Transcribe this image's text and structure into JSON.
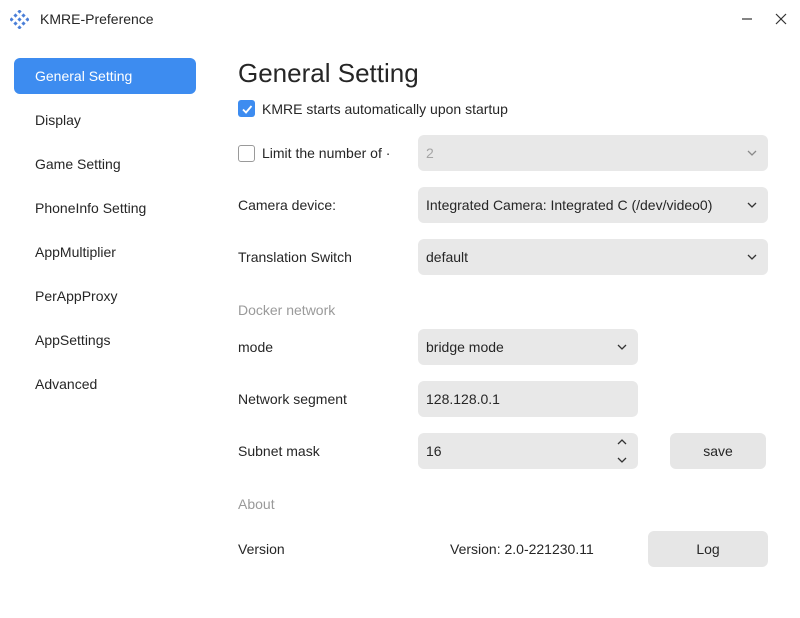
{
  "window": {
    "title": "KMRE-Preference",
    "logo_icon": "app-logo-icon",
    "minimize_icon": "minimize-icon",
    "close_icon": "close-icon"
  },
  "sidebar": {
    "items": [
      {
        "label": "General Setting",
        "active": true
      },
      {
        "label": "Display"
      },
      {
        "label": "Game Setting"
      },
      {
        "label": "PhoneInfo Setting"
      },
      {
        "label": "AppMultiplier"
      },
      {
        "label": "PerAppProxy"
      },
      {
        "label": "AppSettings"
      },
      {
        "label": "Advanced"
      }
    ]
  },
  "main": {
    "title": "General Setting",
    "autostart": {
      "label": "KMRE starts automatically upon startup",
      "checked": true
    },
    "limit": {
      "label": "Limit the number of ·",
      "checked": false,
      "value": "2"
    },
    "camera": {
      "label": "Camera device:",
      "value": "Integrated Camera: Integrated C (/dev/video0)"
    },
    "translation": {
      "label": "Translation Switch",
      "value": "default"
    },
    "docker": {
      "section_label": "Docker network",
      "mode_label": "mode",
      "mode_value": "bridge mode",
      "segment_label": "Network segment",
      "segment_value": "128.128.0.1",
      "mask_label": "Subnet mask",
      "mask_value": "16",
      "save_label": "save"
    },
    "about": {
      "section_label": "About",
      "version_label": "Version",
      "version_value": "Version: 2.0-221230.11",
      "log_label": "Log"
    }
  },
  "colors": {
    "accent": "#3d8cf0",
    "field_bg": "#e8e8e8",
    "section_text": "#9a9a9a"
  }
}
